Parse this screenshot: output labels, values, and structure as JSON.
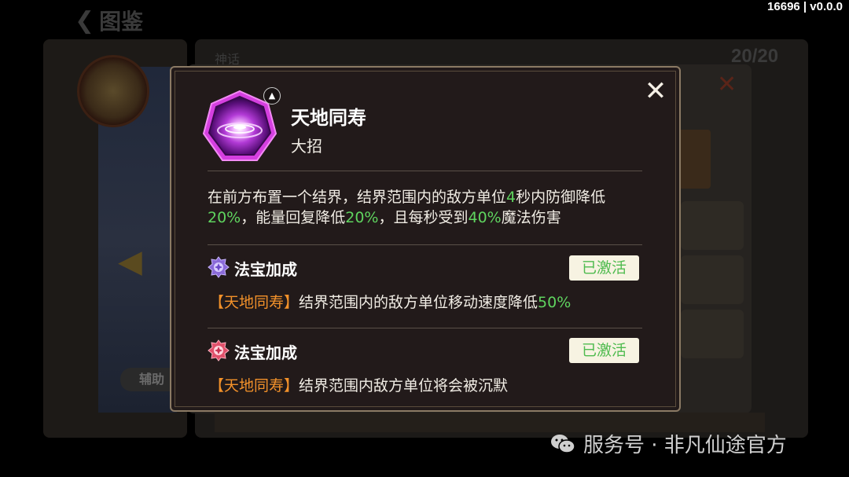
{
  "version": "16696 | v0.0.0",
  "background": {
    "header_title": "图鉴",
    "side_button": "辅助",
    "tab_label": "神话",
    "count": "20/20"
  },
  "skill": {
    "name": "天地同寿",
    "type": "大招",
    "description_parts": [
      {
        "text": "在前方布置一个结界，结界范围内的敌方单位",
        "hl": false
      },
      {
        "text": "4",
        "hl": true
      },
      {
        "text": "秒内防御降低",
        "hl": false
      },
      {
        "text": "20%",
        "hl": true
      },
      {
        "text": "，能量回复降低",
        "hl": false
      },
      {
        "text": "20%",
        "hl": true
      },
      {
        "text": "，且每秒受到",
        "hl": false
      },
      {
        "text": "40%",
        "hl": true
      },
      {
        "text": "魔法伤害",
        "hl": false
      }
    ]
  },
  "bonuses": [
    {
      "title": "法宝加成",
      "status": "已激活",
      "skill_ref": "【天地同寿】",
      "text": "结界范围内的敌方单位移动速度降低",
      "value": "50%",
      "icon_color": "#8a6ad8"
    },
    {
      "title": "法宝加成",
      "status": "已激活",
      "skill_ref": "【天地同寿】",
      "text": "结界范围内敌方单位将会被沉默",
      "value": "",
      "icon_color": "#e0506a"
    }
  ],
  "watermark": "服务号 · 非凡仙途官方",
  "colors": {
    "highlight_green": "#5fd45f",
    "skill_ref_orange": "#f2912a",
    "active_badge_text": "#4fbb4f",
    "dialog_border": "#8b7a64"
  },
  "icons": {
    "close": "close-icon",
    "collapse": "chevron-up-icon",
    "skill": "purple-vortex-skill-icon",
    "bonus_1": "purple-treasure-icon",
    "bonus_2": "red-treasure-icon",
    "watermark": "wechat-icon"
  }
}
